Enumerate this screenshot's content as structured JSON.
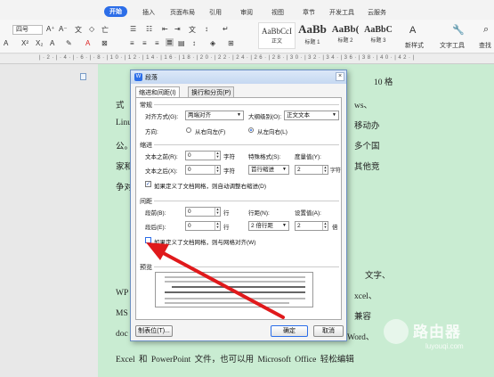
{
  "ribbon_tabs": [
    "开始",
    "插入",
    "页面布局",
    "引用",
    "审阅",
    "视图",
    "章节",
    "开发工具",
    "云服务"
  ],
  "ribbon": {
    "font_size": "四号",
    "style_gallery": [
      {
        "sample": "AaBbCcI",
        "label": "正文"
      },
      {
        "sample": "AaBb",
        "label": "标题 1"
      },
      {
        "sample": "AaBb(",
        "label": "标题 2"
      },
      {
        "sample": "AaBbC",
        "label": "标题 3"
      }
    ],
    "new_style": "新样式",
    "text_tools": "文字工具",
    "find": "查找"
  },
  "document": {
    "lines": [
      {
        "left": "式",
        "right": "ws、"
      },
      {
        "left": "Linu",
        "right": "移动办"
      },
      {
        "left": "公。",
        "right": "多个国"
      },
      {
        "left": "家和",
        "right": "其他竞"
      },
      {
        "left": "争对",
        "right": ""
      }
    ],
    "top_right": "10 格",
    "lower_lines": [
      {
        "left": "WP",
        "right": "xcel、"
      },
      {
        "left": "MS",
        "right": "兼容"
      },
      {
        "left": "doc",
        "right": "Word、"
      }
    ],
    "mid_right": "文字、",
    "last_line": "Excel 和 PowerPoint 文件，也可以用 Microsoft Office 轻松编辑"
  },
  "dialog": {
    "title": "段落",
    "close": "×",
    "tabs": [
      "缩进和间距(I)",
      "换行和分页(P)"
    ],
    "general": {
      "section": "常规",
      "alignment_label": "对齐方式(G):",
      "alignment_value": "两端对齐",
      "outline_label": "大纲级别(O):",
      "outline_value": "正文文本",
      "direction_label": "方向:",
      "rtl": "从右向左(F)",
      "ltr": "从左向右(L)"
    },
    "indent": {
      "section": "缩进",
      "before_label": "文本之前(R):",
      "before_value": "0",
      "before_unit": "字符",
      "special_label": "特殊格式(S):",
      "measure_label": "度量值(Y):",
      "after_label": "文本之后(X):",
      "after_value": "0",
      "after_unit": "字符",
      "special_value": "首行缩进",
      "measure_value": "2",
      "measure_unit": "字符",
      "grid_check": "如果定义了文档网格，则自动调整右缩进(D)"
    },
    "spacing": {
      "section": "间距",
      "before_label": "段前(B):",
      "before_value": "0",
      "before_unit": "行",
      "line_label": "行距(N):",
      "setting_label": "设置值(A):",
      "after_label": "段后(E):",
      "after_value": "0",
      "after_unit": "行",
      "line_value": "2 倍行距",
      "setting_value": "2",
      "setting_unit": "倍",
      "grid_check": "如果定义了文档网格，则与网格对齐(W)"
    },
    "preview": {
      "section": "预览"
    },
    "buttons": {
      "tabs": "制表位(T)...",
      "ok": "确定",
      "cancel": "取消"
    }
  },
  "watermark": {
    "title": "路由器",
    "url": "luyouqi.com"
  },
  "colors": {
    "accent": "#2b6de8",
    "page": "#c9ecd2",
    "arrow": "#e0191b"
  }
}
